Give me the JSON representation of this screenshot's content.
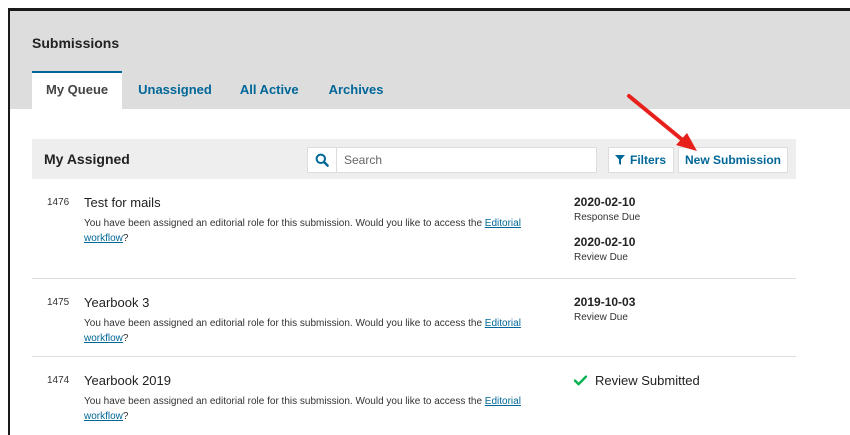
{
  "page": {
    "title": "Submissions"
  },
  "tabs": [
    {
      "label": "My Queue",
      "active": true
    },
    {
      "label": "Unassigned",
      "active": false
    },
    {
      "label": "All Active",
      "active": false
    },
    {
      "label": "Archives",
      "active": false
    }
  ],
  "panel": {
    "title": "My Assigned",
    "search": {
      "placeholder": "Search",
      "value": ""
    },
    "filters_label": "Filters",
    "new_submission_label": "New Submission"
  },
  "submissions": [
    {
      "id": "1476",
      "title": "Test for mails",
      "notice_text": "You have been assigned an editorial role for this submission. Would you like to access the ",
      "link_text_1": "Editorial",
      "link_text_2": "workflow",
      "notice_end": "?",
      "dues": [
        {
          "date": "2020-02-10",
          "label": "Response Due"
        },
        {
          "date": "2020-02-10",
          "label": "Review Due"
        }
      ]
    },
    {
      "id": "1475",
      "title": "Yearbook 3",
      "notice_text": "You have been assigned an editorial role for this submission. Would you like to access the ",
      "link_text_1": "Editorial",
      "link_text_2": "workflow",
      "notice_end": "?",
      "dues": [
        {
          "date": "2019-10-03",
          "label": "Review Due"
        }
      ]
    },
    {
      "id": "1474",
      "title": "Yearbook 2019",
      "notice_text": "You have been assigned an editorial role for this submission. Would you like to access the ",
      "link_text_1": "Editorial",
      "link_text_2": "workflow",
      "notice_end": "?",
      "status": "Review Submitted"
    }
  ],
  "colors": {
    "accent": "#006798",
    "check": "#00b24e",
    "arrow": "#e8201c"
  },
  "icons": [
    "search-icon",
    "filter-icon",
    "check-icon"
  ]
}
